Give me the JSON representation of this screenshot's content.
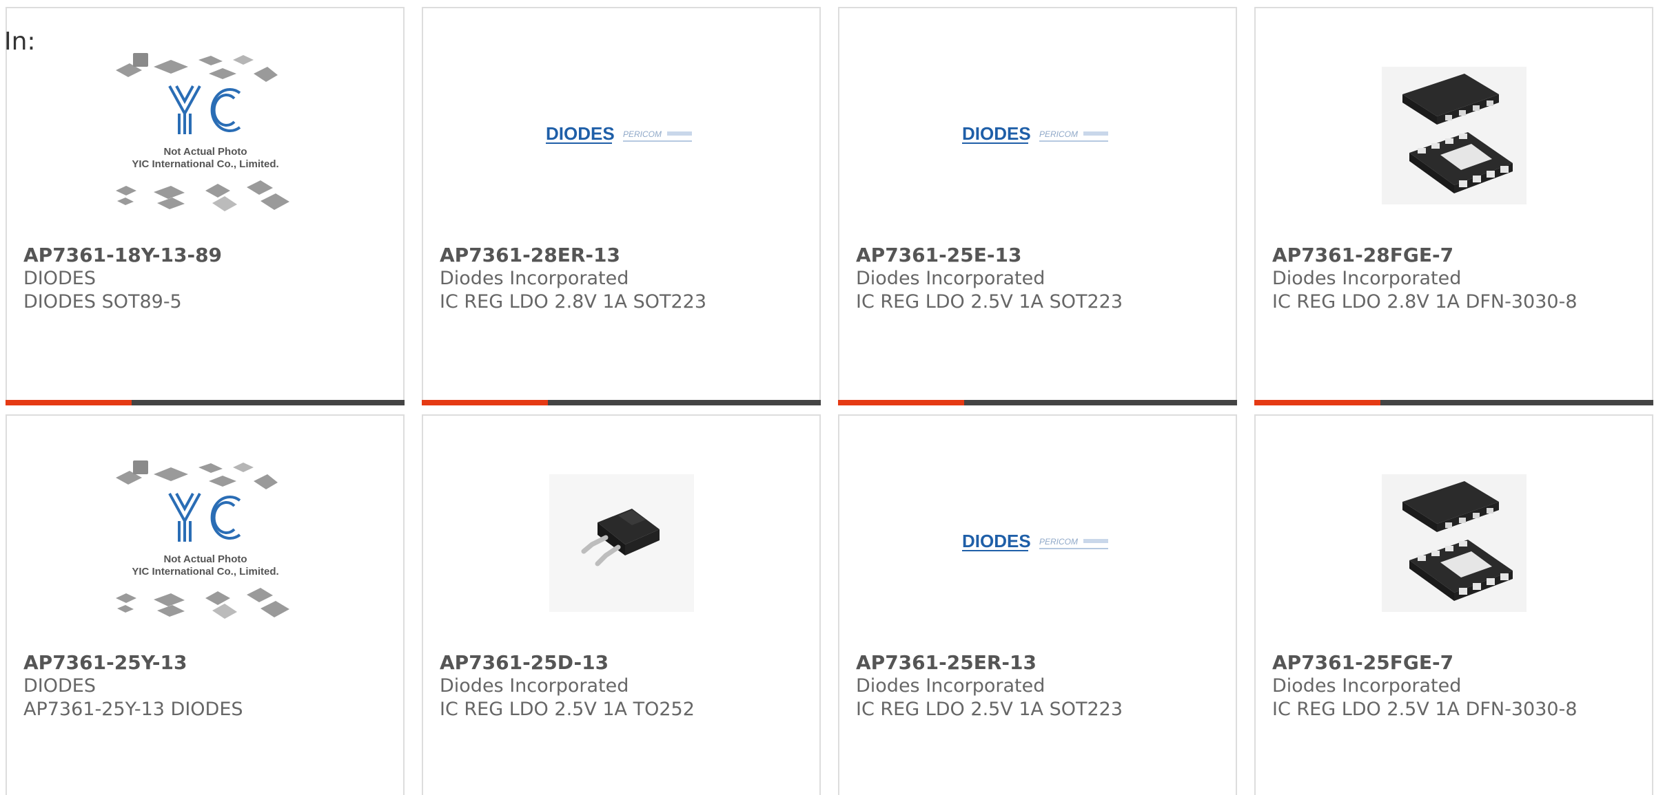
{
  "header": {
    "in_label": "In:"
  },
  "colors": {
    "accent": "#e53a14",
    "bar": "#444444",
    "border": "#dddddd",
    "brand_blue": "#1f5fa8"
  },
  "yic_placeholder": {
    "logo": "YIC",
    "line1": "Not Actual Photo",
    "line2": "YIC International Co., Limited."
  },
  "brand_logo": {
    "left": "DIODES",
    "right": "PERICOM"
  },
  "cards": [
    {
      "part": "AP7361-18Y-13-89",
      "manufacturer": "DIODES",
      "description": "DIODES SOT89-5",
      "image": "yic-placeholder"
    },
    {
      "part": "AP7361-28ER-13",
      "manufacturer": "Diodes Incorporated",
      "description": "IC REG LDO 2.8V 1A SOT223",
      "image": "diodes-pericom-logo"
    },
    {
      "part": "AP7361-25E-13",
      "manufacturer": "Diodes Incorporated",
      "description": "IC REG LDO 2.5V 1A SOT223",
      "image": "diodes-pericom-logo"
    },
    {
      "part": "AP7361-28FGE-7",
      "manufacturer": "Diodes Incorporated",
      "description": "IC REG LDO 2.8V 1A DFN-3030-8",
      "image": "dfn-package"
    },
    {
      "part": "AP7361-25Y-13",
      "manufacturer": "DIODES",
      "description": "AP7361-25Y-13 DIODES",
      "image": "yic-placeholder"
    },
    {
      "part": "AP7361-25D-13",
      "manufacturer": "Diodes Incorporated",
      "description": "IC REG LDO 2.5V 1A TO252",
      "image": "to252-package"
    },
    {
      "part": "AP7361-25ER-13",
      "manufacturer": "Diodes Incorporated",
      "description": "IC REG LDO 2.5V 1A SOT223",
      "image": "diodes-pericom-logo"
    },
    {
      "part": "AP7361-25FGE-7",
      "manufacturer": "Diodes Incorporated",
      "description": "IC REG LDO 2.5V 1A DFN-3030-8",
      "image": "dfn-package"
    }
  ]
}
